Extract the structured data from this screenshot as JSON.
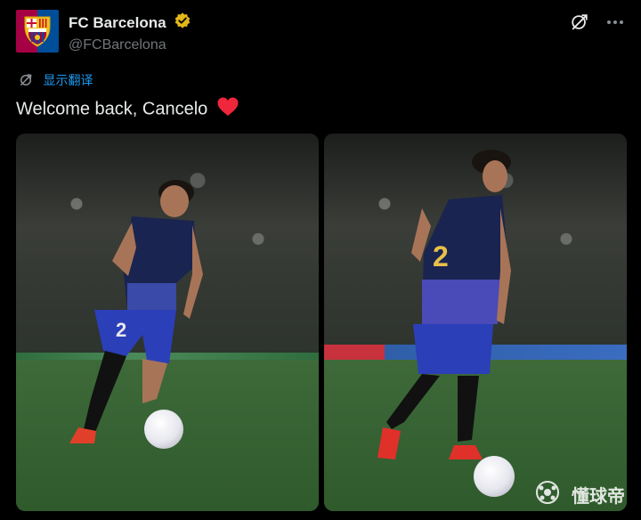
{
  "author": {
    "display_name": "FC Barcelona",
    "handle": "@FCBarcelona",
    "verified_icon": "verified-badge-gold",
    "avatar_icon": "fcb-crest"
  },
  "translate": {
    "label": "显示翻译",
    "icon": "translate-icon"
  },
  "tweet": {
    "text": "Welcome back, Cancelo",
    "emoji": "red-heart"
  },
  "media": {
    "left": {
      "description_icon": "photo"
    },
    "right": {
      "description_icon": "photo"
    }
  },
  "watermark": {
    "text": "懂球帝"
  },
  "colors": {
    "accent": "#1d9bf0",
    "text": "#e7e9ea",
    "muted": "#71767b",
    "verified": "#e2b719",
    "heart": "#f0263b"
  }
}
